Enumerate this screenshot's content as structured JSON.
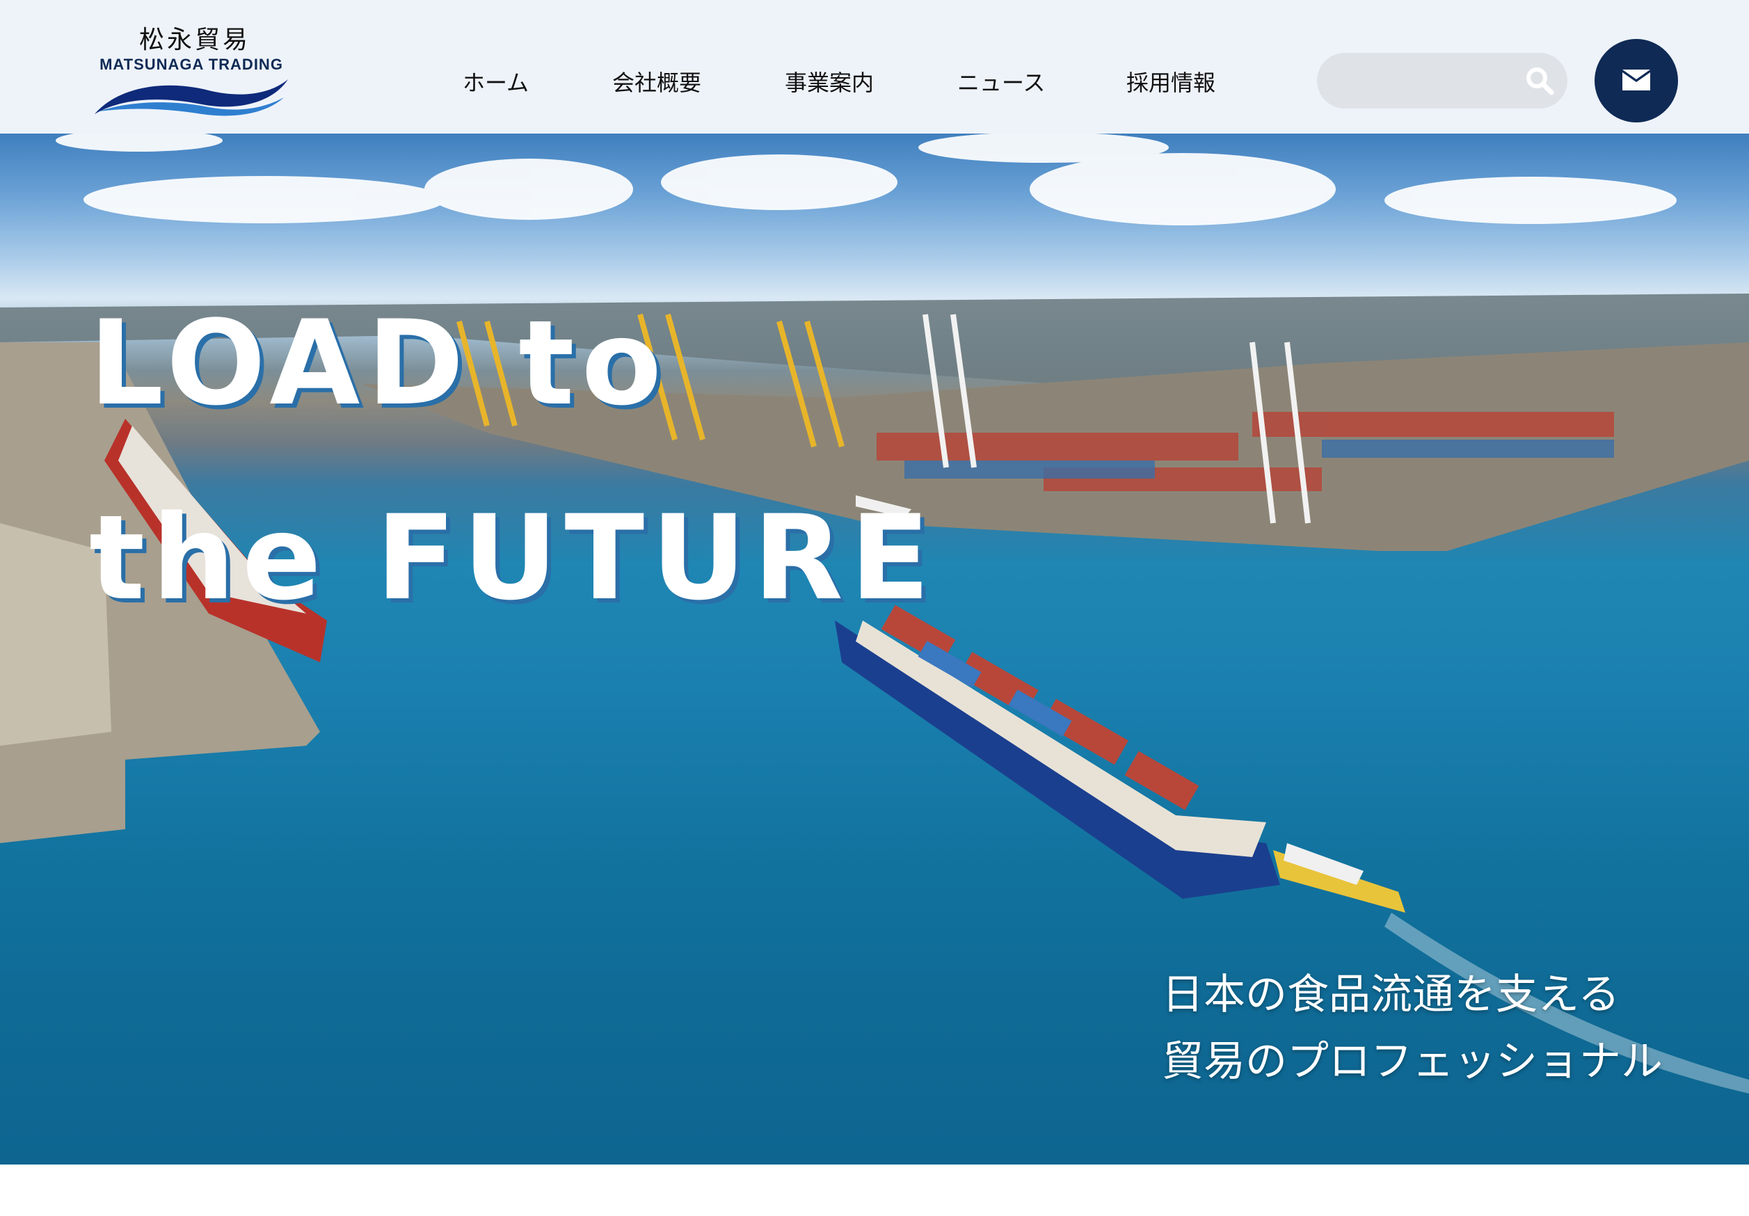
{
  "header": {
    "logo_kanji": "松永貿易",
    "logo_text": "MATSUNAGA TRADING",
    "nav": [
      {
        "label": "ホーム"
      },
      {
        "label": "会社概要"
      },
      {
        "label": "事業案内"
      },
      {
        "label": "ニュース"
      },
      {
        "label": "採用情報"
      }
    ],
    "search": {
      "placeholder": "",
      "icon": "search-icon"
    },
    "contact_icon": "mail-icon"
  },
  "hero": {
    "title_line1": "LOAD to",
    "title_line2": "the FUTURE",
    "tagline_line1": "日本の食品流通を支える",
    "tagline_line2": "貿易のプロフェッショナル"
  },
  "colors": {
    "header_bg": "#eef3fa",
    "brand_navy": "#0f2a55",
    "search_bg": "#dfe3e8",
    "title_shadow": "#2a6fa8"
  }
}
